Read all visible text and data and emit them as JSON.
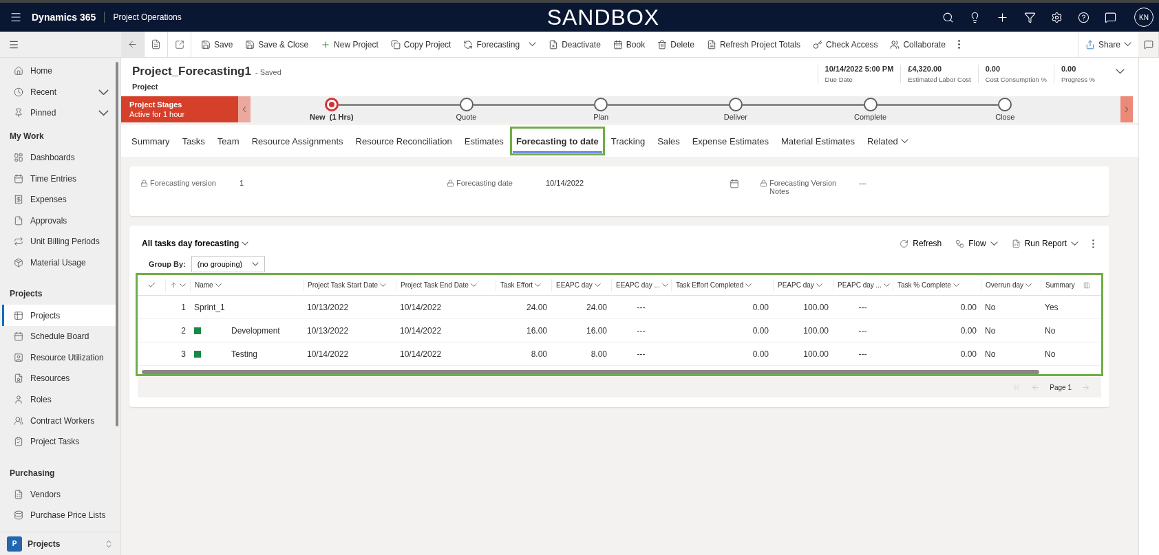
{
  "top_bar": {
    "app_name": "Dynamics 365",
    "area_name": "Project Operations",
    "environment": "SANDBOX",
    "user_initials": "KN"
  },
  "toolbar": {
    "items": [
      {
        "label": "Save",
        "has_caret": false
      },
      {
        "label": "Save & Close",
        "has_caret": false
      },
      {
        "label": "New Project",
        "has_caret": false
      },
      {
        "label": "Copy Project",
        "has_caret": false
      },
      {
        "label": "Forecasting",
        "has_caret": true
      },
      {
        "label": "Deactivate",
        "has_caret": false
      },
      {
        "label": "Book",
        "has_caret": false
      },
      {
        "label": "Delete",
        "has_caret": false
      },
      {
        "label": "Refresh Project Totals",
        "has_caret": false
      },
      {
        "label": "Check Access",
        "has_caret": false
      },
      {
        "label": "Collaborate",
        "has_caret": false
      }
    ],
    "share": {
      "label": "Share"
    }
  },
  "sidebar": {
    "sections": [
      {
        "items": [
          {
            "label": "Home",
            "has_caret": false,
            "selected": false
          },
          {
            "label": "Recent",
            "has_caret": true,
            "selected": false
          },
          {
            "label": "Pinned",
            "has_caret": true,
            "selected": false
          }
        ]
      },
      {
        "title": "My Work",
        "items": [
          {
            "label": "Dashboards",
            "has_caret": false,
            "selected": false
          },
          {
            "label": "Time Entries",
            "has_caret": false,
            "selected": false
          },
          {
            "label": "Expenses",
            "has_caret": false,
            "selected": false
          },
          {
            "label": "Approvals",
            "has_caret": false,
            "selected": false
          },
          {
            "label": "Unit Billing Periods",
            "has_caret": false,
            "selected": false
          },
          {
            "label": "Material Usage",
            "has_caret": false,
            "selected": false
          }
        ]
      },
      {
        "title": "Projects",
        "items": [
          {
            "label": "Projects",
            "has_caret": false,
            "selected": true
          },
          {
            "label": "Schedule Board",
            "has_caret": false,
            "selected": false
          },
          {
            "label": "Resource Utilization",
            "has_caret": false,
            "selected": false
          },
          {
            "label": "Resources",
            "has_caret": false,
            "selected": false
          },
          {
            "label": "Roles",
            "has_caret": false,
            "selected": false
          },
          {
            "label": "Contract Workers",
            "has_caret": false,
            "selected": false
          },
          {
            "label": "Project Tasks",
            "has_caret": false,
            "selected": false
          }
        ]
      },
      {
        "title": "Purchasing",
        "items": [
          {
            "label": "Vendors",
            "has_caret": false,
            "selected": false
          },
          {
            "label": "Purchase Price Lists",
            "has_caret": false,
            "selected": false
          }
        ]
      }
    ],
    "area_switcher": {
      "badge": "P",
      "label": "Projects"
    }
  },
  "record": {
    "title": "Project_Forecasting1",
    "status": "- Saved",
    "entity": "Project",
    "header_fields": [
      {
        "value": "10/14/2022 5:00 PM",
        "label": "Due Date"
      },
      {
        "value": "£4,320.00",
        "label": "Estimated Labor Cost"
      },
      {
        "value": "0.00",
        "label": "Cost Consumption %"
      },
      {
        "value": "0.00",
        "label": "Progress %"
      }
    ]
  },
  "stages": {
    "title": "Project Stages",
    "duration": "Active for 1 hour",
    "items": [
      {
        "label": "New  (1 Hrs)",
        "selected": true
      },
      {
        "label": "Quote",
        "selected": false
      },
      {
        "label": "Plan",
        "selected": false
      },
      {
        "label": "Deliver",
        "selected": false
      },
      {
        "label": "Complete",
        "selected": false
      },
      {
        "label": "Close",
        "selected": false
      }
    ]
  },
  "tabs": [
    {
      "label": "Summary",
      "selected": false,
      "highlighted": false,
      "has_caret": false
    },
    {
      "label": "Tasks",
      "selected": false,
      "highlighted": false,
      "has_caret": false
    },
    {
      "label": "Team",
      "selected": false,
      "highlighted": false,
      "has_caret": false
    },
    {
      "label": "Resource Assignments",
      "selected": false,
      "highlighted": false,
      "has_caret": false
    },
    {
      "label": "Resource Reconciliation",
      "selected": false,
      "highlighted": false,
      "has_caret": false
    },
    {
      "label": "Estimates",
      "selected": false,
      "highlighted": false,
      "has_caret": false
    },
    {
      "label": "Forecasting to date",
      "selected": true,
      "highlighted": true,
      "has_caret": false
    },
    {
      "label": "Tracking",
      "selected": false,
      "highlighted": false,
      "has_caret": false
    },
    {
      "label": "Sales",
      "selected": false,
      "highlighted": false,
      "has_caret": false
    },
    {
      "label": "Expense Estimates",
      "selected": false,
      "highlighted": false,
      "has_caret": false
    },
    {
      "label": "Material Estimates",
      "selected": false,
      "highlighted": false,
      "has_caret": false
    },
    {
      "label": "Related",
      "selected": false,
      "highlighted": false,
      "has_caret": true
    }
  ],
  "form": {
    "fields": [
      {
        "label": "Forecasting version",
        "value": "1",
        "locked": true,
        "has_calendar": false
      },
      {
        "label": "Forecasting date",
        "value": "10/14/2022",
        "locked": true,
        "has_calendar": true
      },
      {
        "label": "Forecasting Version Notes",
        "value": "---",
        "locked": true,
        "has_calendar": false
      }
    ]
  },
  "grid": {
    "view_title": "All tasks day forecasting",
    "commands": [
      {
        "label": "Refresh",
        "has_caret": false
      },
      {
        "label": "Flow",
        "has_caret": true
      },
      {
        "label": "Run Report",
        "has_caret": true
      }
    ],
    "group_by": {
      "label": "Group By:",
      "value": "(no grouping)"
    },
    "highlighted": true,
    "columns": [
      "Name",
      "Project Task Start Date",
      "Project Task End Date",
      "Task Effort",
      "EEAPC day",
      "EEAPC day ...",
      "Task Effort Completed",
      "PEAPC day",
      "PEAPC day ...",
      "Task % Complete",
      "Overrun day",
      "Summary"
    ],
    "rows": [
      {
        "number": "1",
        "cells": [
          "Sprint_1",
          "10/13/2022",
          "10/14/2022",
          "24.00",
          "24.00",
          "---",
          "0.00",
          "100.00",
          "---",
          "0.00",
          "No",
          "Yes"
        ],
        "children": [
          {
            "number": "2",
            "cells": [
              "Development",
              "10/13/2022",
              "10/14/2022",
              "16.00",
              "16.00",
              "---",
              "0.00",
              "100.00",
              "---",
              "0.00",
              "No",
              "No"
            ]
          },
          {
            "number": "3",
            "cells": [
              "Testing",
              "10/14/2022",
              "10/14/2022",
              "8.00",
              "8.00",
              "---",
              "0.00",
              "100.00",
              "---",
              "0.00",
              "No",
              "No"
            ]
          }
        ]
      }
    ],
    "pager": "Page 1"
  }
}
